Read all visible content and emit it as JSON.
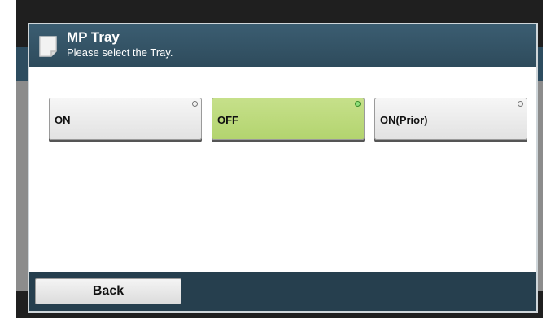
{
  "dialog": {
    "title": "MP Tray",
    "subtitle": "Please select the Tray.",
    "icon": "document-icon"
  },
  "options": [
    {
      "label": "ON",
      "selected": false
    },
    {
      "label": "OFF",
      "selected": true
    },
    {
      "label": "ON(Prior)",
      "selected": false
    }
  ],
  "footer": {
    "back_label": "Back"
  },
  "colors": {
    "title_bar": "#2e4b5c",
    "selected": "#b3d46f",
    "footer": "#263f4e"
  }
}
